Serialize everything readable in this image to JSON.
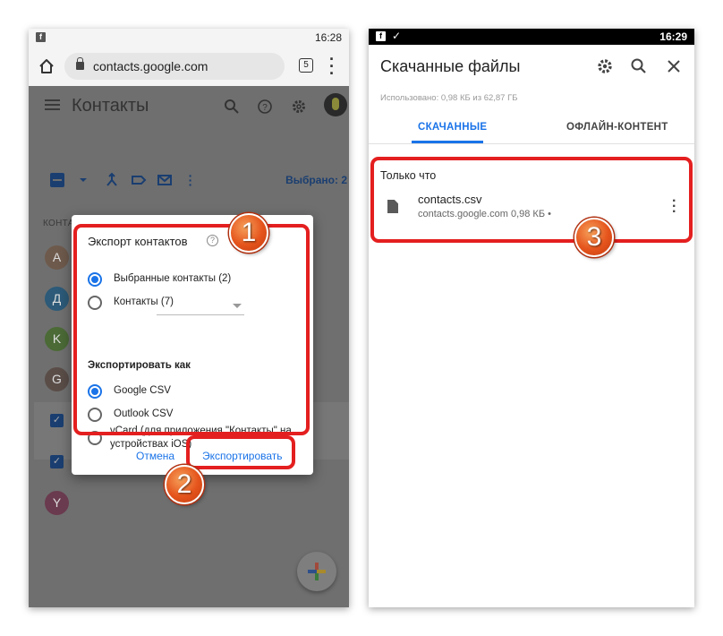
{
  "left": {
    "status_time": "16:28",
    "browser": {
      "url": "contacts.google.com",
      "tab_count": "5"
    },
    "app": {
      "title": "Контакты"
    },
    "toolbar": {
      "selected_text": "Выбрано: 2"
    },
    "contacts_section": "КОНТАКТЫ (7)",
    "contact_initials": [
      "A",
      "Д",
      "K",
      "G",
      "Y"
    ],
    "dialog": {
      "title": "Экспорт контактов",
      "option_selected": "Выбранные контакты (2)",
      "option_contacts": "Контакты (7)",
      "export_as_label": "Экспортировать как",
      "format_google": "Google CSV",
      "format_outlook": "Outlook CSV",
      "format_vcard": "vCard (для приложения \"Контакты\" на устройствах iOS)",
      "cancel_label": "Отмена",
      "export_label": "Экспортировать"
    }
  },
  "right": {
    "status_time": "16:29",
    "title": "Скачанные файлы",
    "usage": "Использовано: 0,98 КБ из 62,87 ГБ",
    "tabs": {
      "downloads": "СКАЧАННЫЕ",
      "offline": "ОФЛАЙН-КОНТЕНТ"
    },
    "section": "Только что",
    "file": {
      "name": "contacts.csv",
      "meta": "contacts.google.com 0,98 КБ •"
    }
  },
  "badges": [
    "1",
    "2",
    "3"
  ],
  "colors": {
    "highlight": "#e41f1f",
    "accent": "#1a73e8",
    "badge": "#e5541c"
  }
}
